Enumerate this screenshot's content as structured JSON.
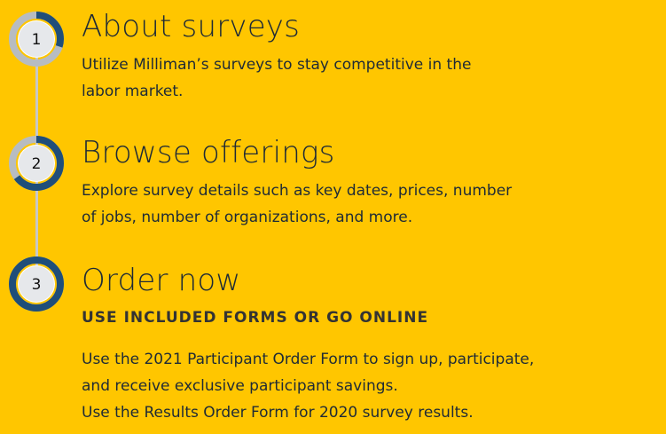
{
  "colors": {
    "background": "#FFC600",
    "ring_fill": "#1F4E79",
    "ring_track": "#B7BCC1",
    "badge_center": "#FFFFFF",
    "timeline": "#C8C8C8"
  },
  "steps": [
    {
      "number": "1",
      "title": "About surveys",
      "description_lines": [
        "Utilize Milliman’s surveys to stay competitive in the",
        "labor market."
      ],
      "progress": 0.3
    },
    {
      "number": "2",
      "title": "Browse offerings",
      "description_lines": [
        "Explore survey details such as key dates, prices, number",
        "of jobs, number of organizations, and more."
      ],
      "progress": 0.65
    },
    {
      "number": "3",
      "title": "Order now",
      "subtitle": "USE INCLUDED FORMS OR GO ONLINE",
      "description_lines": [
        "Use the 2021 Participant Order Form to sign up, participate,",
        "and receive exclusive participant savings.",
        "Use the Results Order Form for 2020 survey results."
      ],
      "progress": 1.0
    }
  ]
}
